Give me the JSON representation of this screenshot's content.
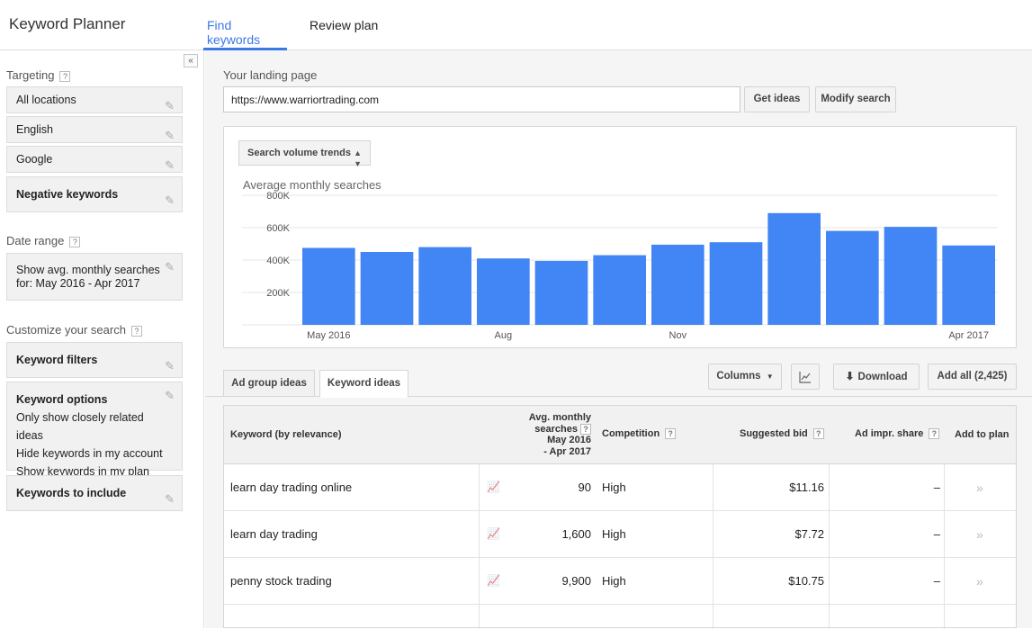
{
  "app": {
    "title": "Keyword Planner"
  },
  "tabs": [
    {
      "label": "Find keywords",
      "active": true
    },
    {
      "label": "Review plan",
      "active": false
    }
  ],
  "sidebar": {
    "collapse_icon": "«",
    "targeting": {
      "label": "Targeting",
      "items": [
        "All locations",
        "English",
        "Google",
        "Negative keywords"
      ]
    },
    "date_range": {
      "label": "Date range",
      "value_line1": "Show avg. monthly searches",
      "value_line2": "for: May 2016 - Apr 2017"
    },
    "customize": {
      "label": "Customize your search",
      "keyword_filters": "Keyword filters",
      "keyword_options": {
        "title": "Keyword options",
        "lines": [
          "Only show closely related ideas",
          "Hide keywords in my account",
          "Show keywords in my plan"
        ]
      },
      "keywords_to_include": "Keywords to include"
    },
    "help_glyph": "?"
  },
  "landing": {
    "label": "Your landing page",
    "url": "https://www.warriortrading.com",
    "get_ideas": "Get ideas",
    "modify_search": "Modify search"
  },
  "chart_panel": {
    "select_label": "Search volume trends",
    "title": "Average monthly searches"
  },
  "chart_data": {
    "type": "bar",
    "title": "Average monthly searches",
    "categories": [
      "May 2016",
      "Jun 2016",
      "Jul 2016",
      "Aug 2016",
      "Sep 2016",
      "Oct 2016",
      "Nov 2016",
      "Dec 2016",
      "Jan 2017",
      "Feb 2017",
      "Mar 2017",
      "Apr 2017"
    ],
    "values": [
      475000,
      450000,
      480000,
      410000,
      395000,
      430000,
      495000,
      510000,
      690000,
      580000,
      605000,
      490000
    ],
    "ylim": [
      0,
      800000
    ],
    "yticks": [
      200000,
      400000,
      600000,
      800000
    ],
    "ytick_labels": [
      "200K",
      "400K",
      "600K",
      "800K"
    ],
    "xtick_labels": [
      "May 2016",
      "Aug",
      "Nov",
      "Apr 2017"
    ],
    "xtick_indices": [
      0,
      3,
      6,
      11
    ],
    "bar_color": "#4285f4",
    "grid": true
  },
  "idea_tabs": [
    {
      "label": "Ad group ideas",
      "active": false
    },
    {
      "label": "Keyword ideas",
      "active": true
    }
  ],
  "toolbar": {
    "columns": "Columns",
    "chart_icon": "line-chart-icon",
    "download": "Download",
    "add_all": "Add all (2,425)"
  },
  "table": {
    "headers": {
      "keyword": "Keyword (by relevance)",
      "avg_line1": "Avg. monthly",
      "avg_line2": "searches",
      "avg_line3": "May 2016",
      "avg_line4": "- Apr 2017",
      "competition": "Competition",
      "bid": "Suggested bid",
      "impr": "Ad impr. share",
      "add": "Add to plan"
    },
    "rows": [
      {
        "keyword": "learn day trading online",
        "searches": "90",
        "competition": "High",
        "bid": "$11.16",
        "impr": "–"
      },
      {
        "keyword": "learn day trading",
        "searches": "1,600",
        "competition": "High",
        "bid": "$7.72",
        "impr": "–"
      },
      {
        "keyword": "penny stock trading",
        "searches": "9,900",
        "competition": "High",
        "bid": "$10.75",
        "impr": "–"
      }
    ]
  }
}
